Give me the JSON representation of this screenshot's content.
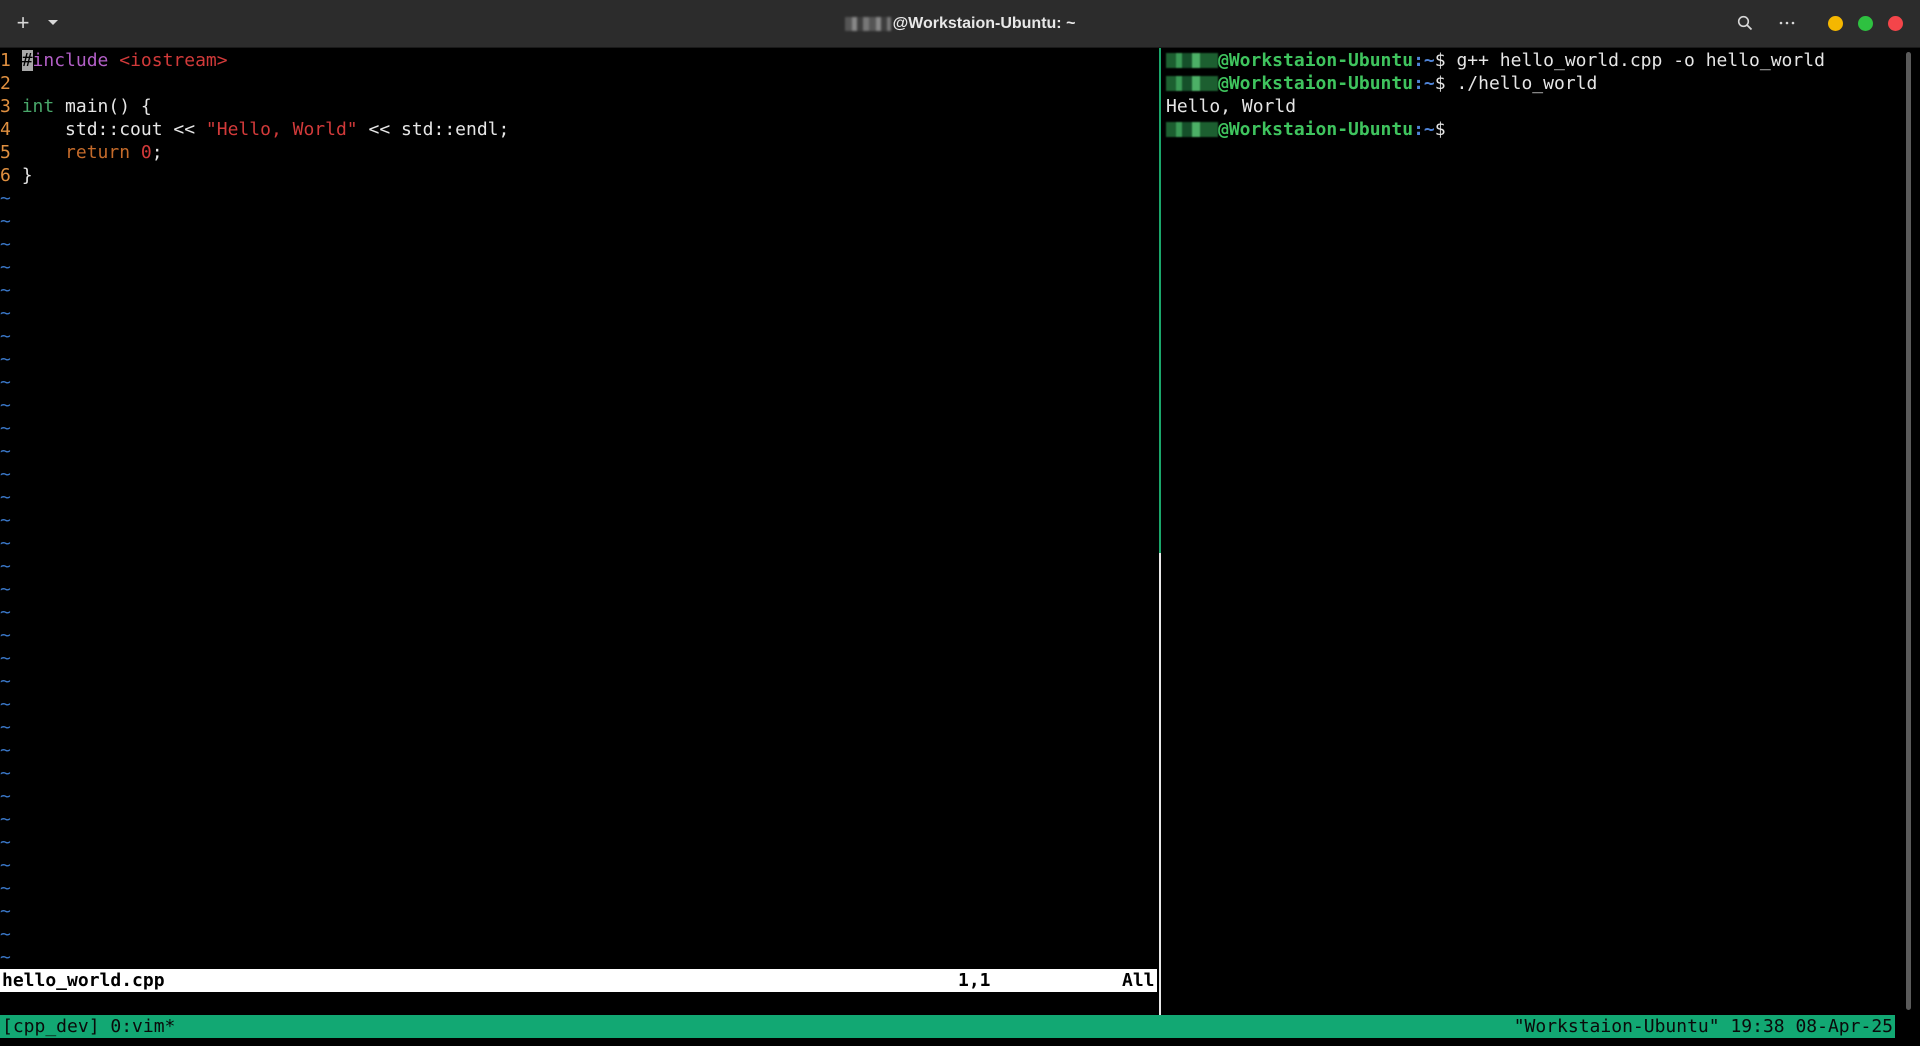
{
  "titlebar": {
    "title": "@Workstaion-Ubuntu: ~",
    "icons": [
      "plus-icon",
      "chevron-down-icon",
      "search-icon",
      "more-icon"
    ]
  },
  "vim": {
    "line_numbers": [
      "1",
      "2",
      "3",
      "4",
      "5",
      "6"
    ],
    "code": {
      "l1_cursor": "#",
      "l1_pre": "include",
      "l1_str": "<iostream>",
      "l3_type": "int",
      "l3_rest": " main() {",
      "l4_a": "    std::cout << ",
      "l4_str": "\"Hello, World\"",
      "l4_b": " << std::endl;",
      "l5_kw": "    return",
      "l5_num": "0",
      "l5_semi": ";",
      "l6": "}"
    },
    "tilde": "~",
    "status": {
      "filename": "hello_world.cpp",
      "position": "1,1",
      "scroll": "All"
    }
  },
  "shell": {
    "host": "@Workstaion-Ubuntu",
    "path": ":~",
    "prompt": "$ ",
    "commands": [
      "g++ hello_world.cpp -o hello_world",
      "./hello_world"
    ],
    "output": "Hello, World"
  },
  "tmux": {
    "left": "[cpp_dev] 0:vim*",
    "right": "\"Workstaion-Ubuntu\" 19:38 08-Apr-25"
  },
  "colors": {
    "titlebar_bg": "#2c2c2c",
    "tmux_bar": "#12a873",
    "host_green": "#3fc45e",
    "path_blue": "#4f83d6",
    "line_number": "#e09040",
    "tilde_blue": "#3a78c9"
  }
}
